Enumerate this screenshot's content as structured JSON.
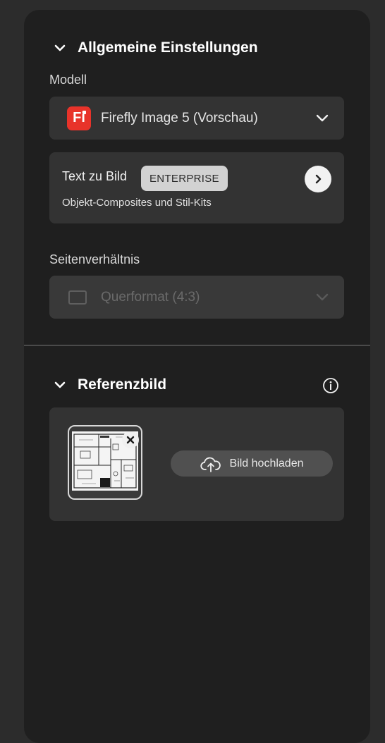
{
  "general": {
    "section_title": "Allgemeine Einstellungen",
    "model_label": "Modell",
    "model": {
      "logo_text": "Fi",
      "name": "Firefly Image 5 (Vorschau)"
    },
    "mode": {
      "title": "Text zu Bild",
      "badge": "ENTERPRISE",
      "subtitle": "Objekt-Composites und Stil-Kits"
    },
    "aspect_label": "Seitenverhältnis",
    "aspect_value": "Querformat (4:3)"
  },
  "reference": {
    "section_title": "Referenzbild",
    "upload_label": "Bild hochladen"
  },
  "icons": {
    "collapse": "chevron-down-icon",
    "select": "chevron-down-icon",
    "arrow": "chevron-right-icon",
    "info": "info-icon",
    "upload": "cloud-upload-icon",
    "remove": "close-icon"
  },
  "colors": {
    "panel_bg": "#1f1f1f",
    "card_bg": "#333333",
    "brand": "#e8332a"
  }
}
